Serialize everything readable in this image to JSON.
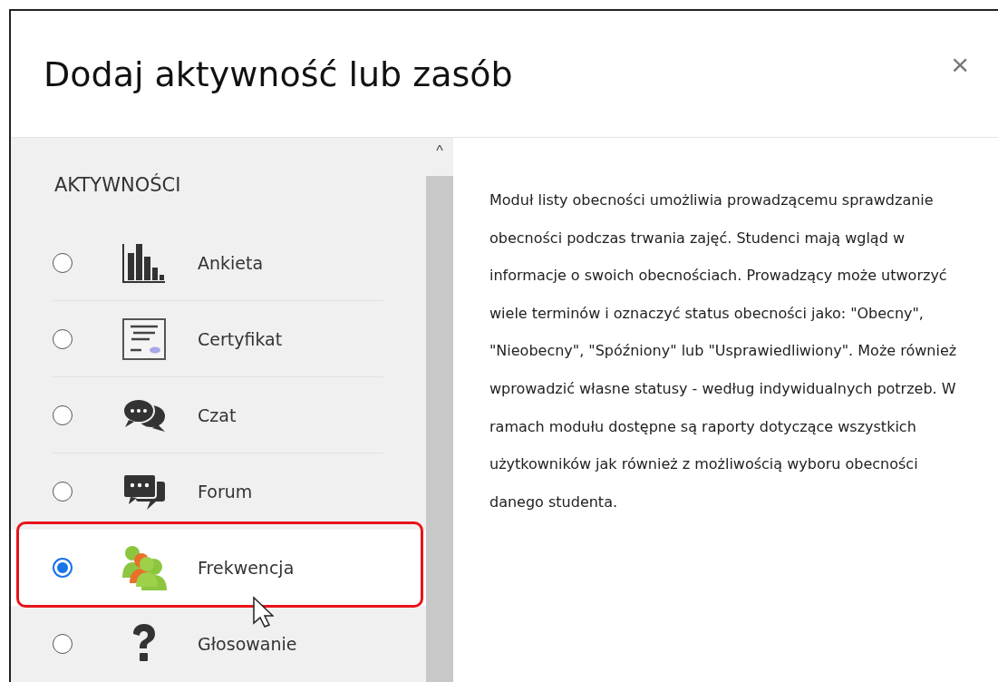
{
  "dialog": {
    "title": "Dodaj aktywność lub zasób",
    "close": "×"
  },
  "section": {
    "heading": "AKTYWNOŚCI"
  },
  "items": [
    {
      "label": "Ankieta",
      "kind": "chart",
      "selected": false
    },
    {
      "label": "Certyfikat",
      "kind": "certificate",
      "selected": false
    },
    {
      "label": "Czat",
      "kind": "chat",
      "selected": false
    },
    {
      "label": "Forum",
      "kind": "forum",
      "selected": false
    },
    {
      "label": "Frekwencja",
      "kind": "people",
      "selected": true
    },
    {
      "label": "Głosowanie",
      "kind": "question",
      "selected": false
    }
  ],
  "scrollbar": {
    "up": "^"
  },
  "description": "Moduł listy obecności umożliwia prowadzącemu sprawdzanie obecności podczas trwania zajęć. Studenci mają wgląd w informacje o swoich obecnościach. Prowadzący może utworzyć wiele terminów i oznaczyć status obecności jako: \"Obecny\", \"Nieobecny\", \"Spóźniony\" lub \"Usprawiedliwiony\". Może również wprowadzić własne statusy - według indywidualnych potrzeb. W ramach modułu dostępne są raporty dotyczące wszystkich użytkowników jak również z możliwością wyboru obecności danego studenta."
}
